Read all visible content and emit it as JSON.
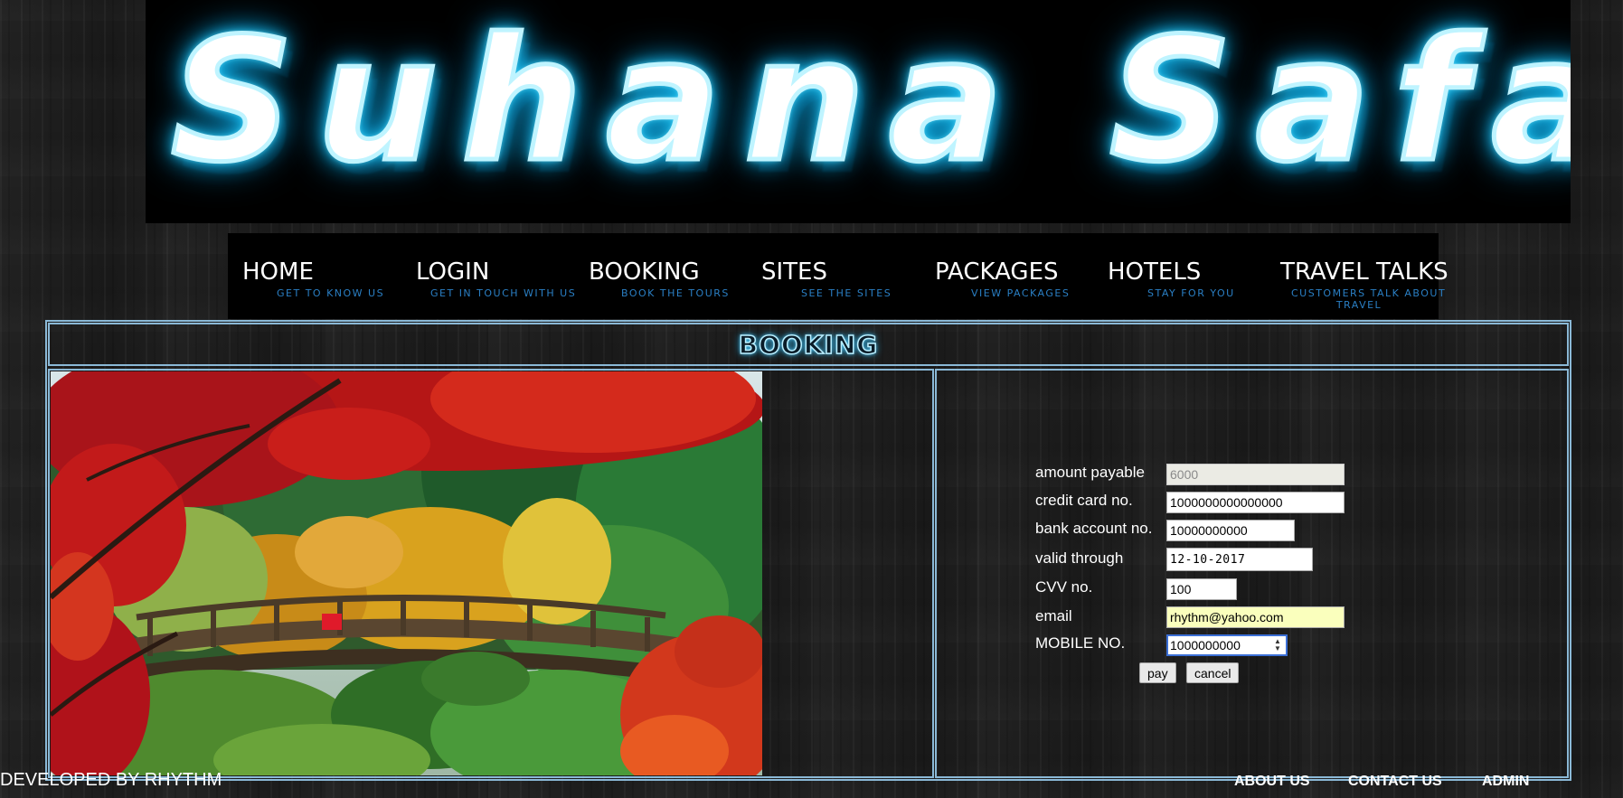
{
  "site": {
    "title": "Suhana Safar"
  },
  "nav": {
    "items": [
      {
        "title": "HOME",
        "subtitle": "GET TO KNOW US"
      },
      {
        "title": "LOGIN",
        "subtitle": "GET IN TOUCH WITH US"
      },
      {
        "title": "BOOKING",
        "subtitle": "BOOK THE TOURS"
      },
      {
        "title": "SITES",
        "subtitle": "SEE THE SITES"
      },
      {
        "title": "PACKAGES",
        "subtitle": "VIEW PACKAGES"
      },
      {
        "title": "HOTELS",
        "subtitle": "STAY FOR YOU"
      },
      {
        "title": "TRAVEL TALKS",
        "subtitle_line1": "CUSTOMERS TALK ABOUT",
        "subtitle_line2": "TRAVEL"
      }
    ]
  },
  "booking": {
    "heading": "BOOKING",
    "image_alt": "Japanese garden with red maple trees and wooden bridge",
    "form": {
      "amount_payable": {
        "label": "amount payable",
        "value": "6000"
      },
      "credit_card": {
        "label": "credit card no.",
        "value": "1000000000000000"
      },
      "bank_account": {
        "label": "bank account no.",
        "value": "10000000000"
      },
      "valid_through": {
        "label": "valid through",
        "value": "12-10-2017"
      },
      "cvv": {
        "label": "CVV no.",
        "value": "100"
      },
      "email": {
        "label": "email",
        "value": "rhythm@yahoo.com"
      },
      "mobile": {
        "label": "MOBILE NO.",
        "value": "1000000000"
      },
      "pay_label": "pay",
      "cancel_label": "cancel"
    }
  },
  "footer": {
    "developer": "DEVELOPED BY RHYTHM",
    "about": "ABOUT US",
    "contact": "CONTACT US",
    "admin": "ADMIN"
  },
  "colors": {
    "accent_glow": "#27c8f5",
    "nav_subtitle": "#2a7fc4",
    "border": "#8ab8d6"
  }
}
